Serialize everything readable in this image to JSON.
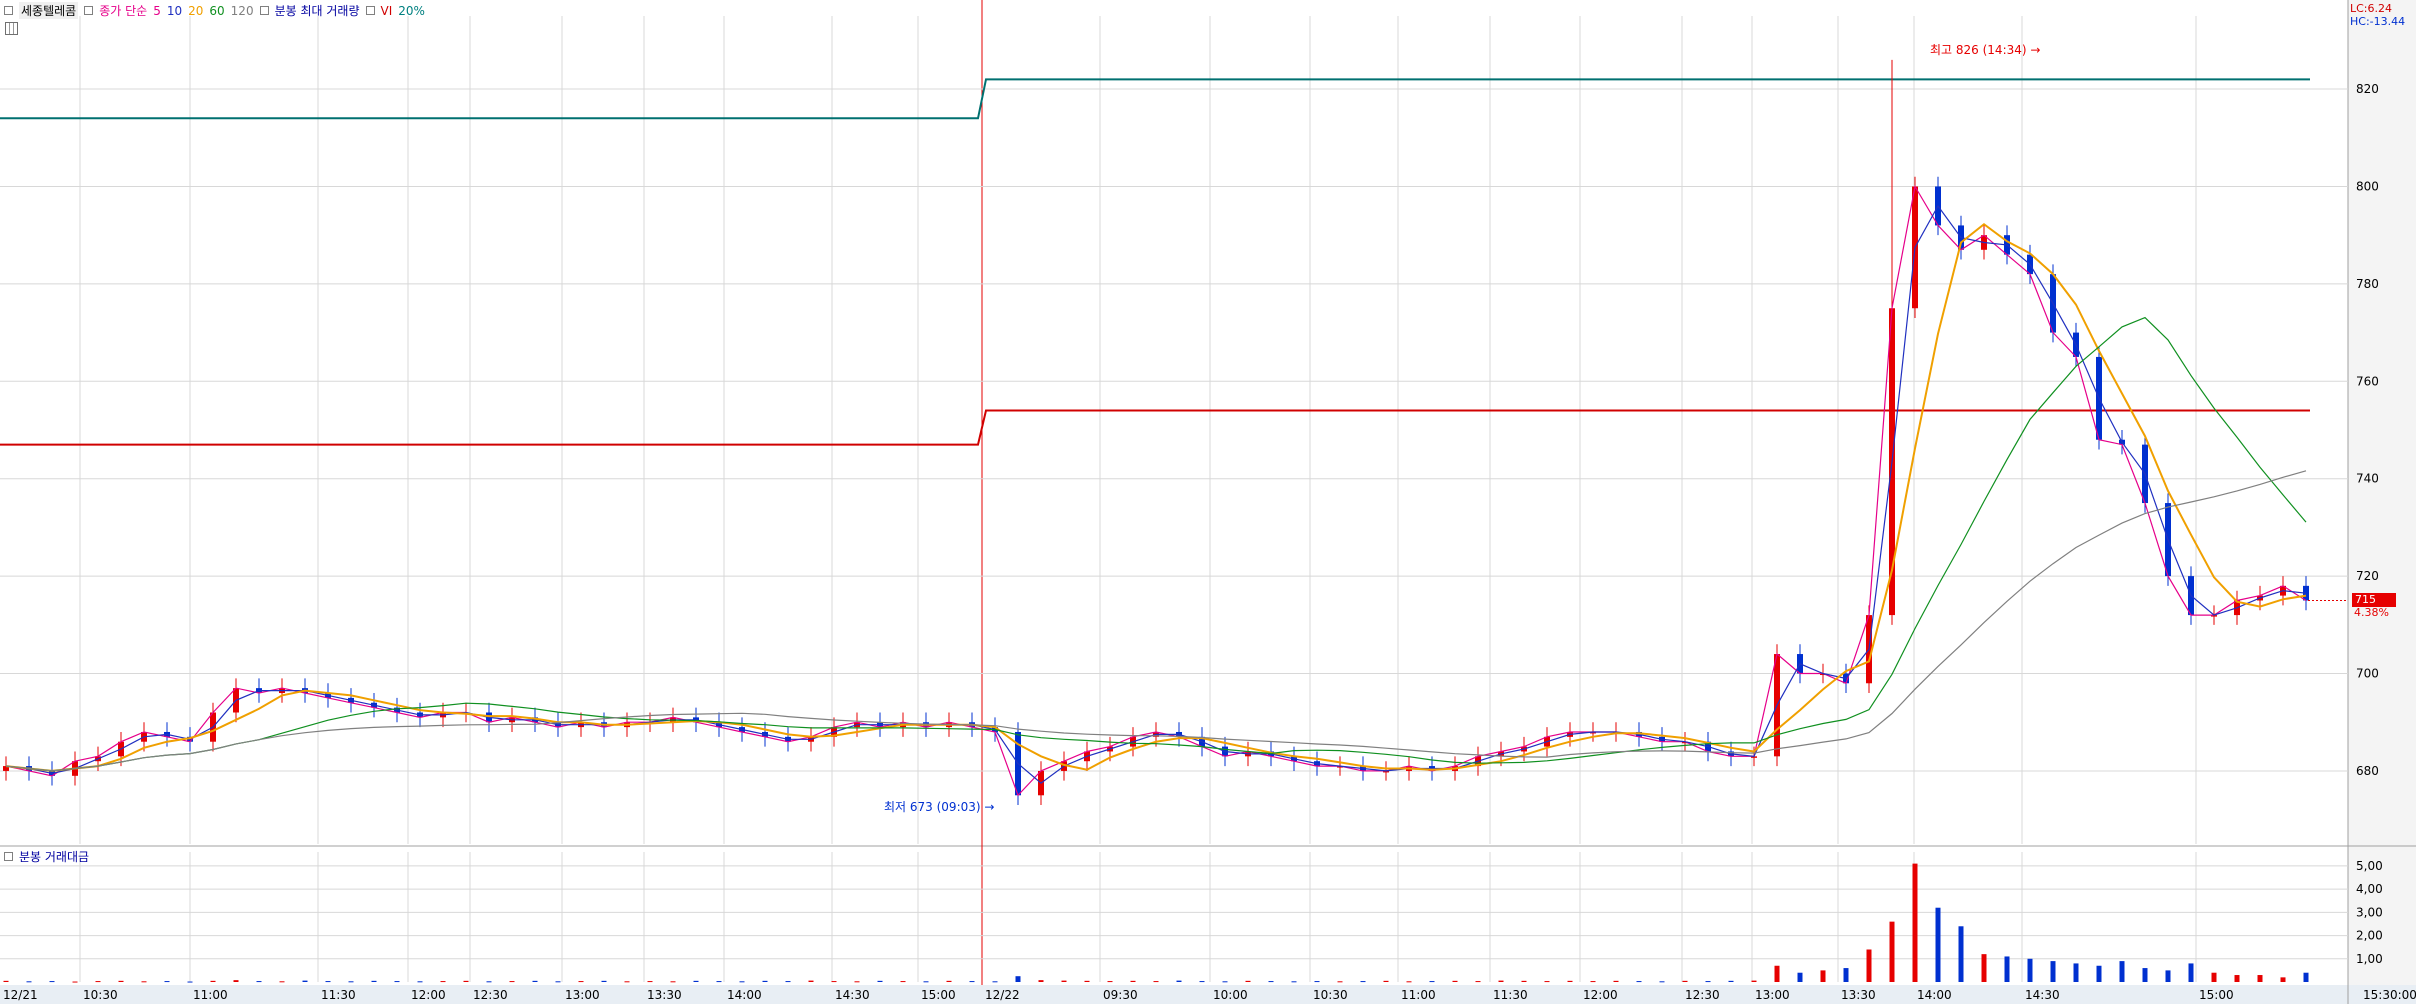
{
  "legend": {
    "stock_name": "세종텔레콤",
    "ma_prefix": "종가 단순",
    "ma_periods": [
      "5",
      "10",
      "20",
      "60",
      "120"
    ],
    "ma_colors": [
      "#e6008a",
      "#2030c0",
      "#f0a000",
      "#109020",
      "#808080"
    ],
    "minute_max_volume": "분봉 최대 거래량",
    "vi_label": "VI",
    "vi_pct": "20%"
  },
  "volume_legend": "분봉 거래대금",
  "lc_label": "LC:6.24",
  "hc_label": "HC:-13.44",
  "current_price": "715",
  "current_change": "4.38%",
  "high_annotation": "최고 826 (14:34)",
  "low_annotation": "최저 673 (09:03)",
  "day_labels": [
    "12/21",
    "12/22"
  ],
  "colors": {
    "up": "#e60000",
    "down": "#0030d0",
    "vi_line": "#d00000",
    "max_line": "#007070",
    "grid": "#d8d8d8"
  },
  "chart_data": {
    "type": "candlestick",
    "y_ticks": [
      "680",
      "700",
      "720",
      "740",
      "760",
      "780",
      "800",
      "820"
    ],
    "ylim": [
      665,
      835
    ],
    "x_tick_labels": [
      "12/21",
      "10:30",
      "11:00",
      "11:30",
      "12:00",
      "12:30",
      "13:00",
      "13:30",
      "14:00",
      "14:30",
      "15:00",
      "12/22",
      "09:30",
      "10:00",
      "10:30",
      "11:00",
      "11:30",
      "12:00",
      "12:30",
      "13:00",
      "13:30",
      "14:00",
      "14:30",
      "15:00",
      "15:30:00"
    ],
    "reference_lines": [
      {
        "name": "VI",
        "day1": 747,
        "day2": 754
      },
      {
        "name": "max",
        "day1": 814,
        "day2": 822
      }
    ],
    "high": {
      "value": 826,
      "time": "14:34"
    },
    "low": {
      "value": 673,
      "time": "09:03"
    },
    "series_closes": [
      681,
      680,
      679,
      682,
      683,
      686,
      688,
      687,
      686,
      692,
      697,
      696,
      697,
      696,
      695,
      694,
      693,
      692,
      691,
      692,
      692,
      690,
      691,
      690,
      689,
      690,
      689,
      690,
      690,
      691,
      690,
      689,
      688,
      687,
      686,
      687,
      689,
      690,
      689,
      690,
      689,
      690,
      689,
      688,
      675,
      680,
      682,
      684,
      685,
      687,
      688,
      687,
      685,
      683,
      684,
      683,
      682,
      681,
      681,
      680,
      680,
      681,
      680,
      681,
      683,
      684,
      685,
      687,
      688,
      688,
      688,
      687,
      686,
      686,
      684,
      683,
      683,
      704,
      700,
      700,
      698,
      712,
      775,
      800,
      792,
      787,
      790,
      786,
      782,
      770,
      765,
      748,
      747,
      735,
      720,
      712,
      712,
      715,
      716,
      718,
      715
    ],
    "volume_panel": {
      "y_ticks": [
        "1,00",
        "2,00",
        "3,00",
        "4,00",
        "5,00"
      ],
      "ylim": [
        0,
        5.6
      ],
      "values": [
        0.05,
        0.03,
        0.04,
        0.02,
        0.04,
        0.05,
        0.03,
        0.04,
        0.02,
        0.05,
        0.08,
        0.04,
        0.03,
        0.06,
        0.04,
        0.03,
        0.05,
        0.04,
        0.03,
        0.04,
        0.05,
        0.03,
        0.04,
        0.05,
        0.03,
        0.04,
        0.05,
        0.03,
        0.04,
        0.03,
        0.05,
        0.04,
        0.03,
        0.05,
        0.04,
        0.06,
        0.04,
        0.03,
        0.05,
        0.04,
        0.03,
        0.05,
        0.04,
        0.03,
        0.25,
        0.08,
        0.06,
        0.05,
        0.04,
        0.05,
        0.04,
        0.06,
        0.04,
        0.03,
        0.05,
        0.04,
        0.03,
        0.04,
        0.03,
        0.04,
        0.05,
        0.03,
        0.04,
        0.05,
        0.04,
        0.06,
        0.05,
        0.04,
        0.05,
        0.04,
        0.05,
        0.04,
        0.03,
        0.05,
        0.04,
        0.05,
        0.06,
        0.7,
        0.4,
        0.5,
        0.6,
        1.4,
        2.6,
        5.1,
        3.2,
        2.4,
        1.2,
        1.1,
        1.0,
        0.9,
        0.8,
        0.7,
        0.9,
        0.6,
        0.5,
        0.8,
        0.4,
        0.3,
        0.3,
        0.2,
        0.4
      ]
    }
  }
}
